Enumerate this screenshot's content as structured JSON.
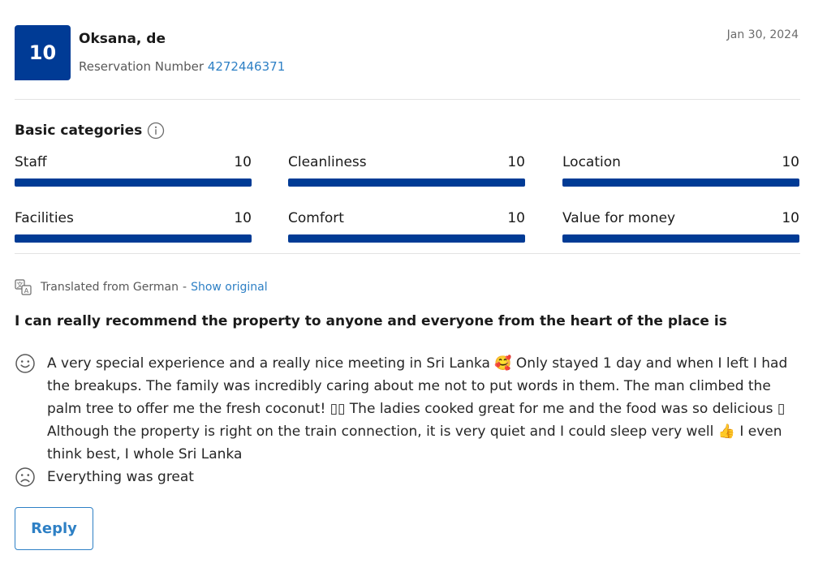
{
  "review": {
    "score": "10",
    "reviewer_name": "Oksana, de",
    "reservation_label": "Reservation Number",
    "reservation_number": "4272446371",
    "date": "Jan 30, 2024"
  },
  "categories": {
    "title": "Basic categories",
    "items": [
      {
        "label": "Staff",
        "score": "10"
      },
      {
        "label": "Cleanliness",
        "score": "10"
      },
      {
        "label": "Location",
        "score": "10"
      },
      {
        "label": "Facilities",
        "score": "10"
      },
      {
        "label": "Comfort",
        "score": "10"
      },
      {
        "label": "Value for money",
        "score": "10"
      }
    ]
  },
  "translation": {
    "label": "Translated from German",
    "separator": "-",
    "link": "Show original"
  },
  "review_title": "I can really recommend the property to anyone and everyone from the heart of the place is",
  "positive_text": "A very special experience and a really nice meeting in Sri Lanka 🥰 Only stayed 1 day and when I left I had the breakups. The family was incredibly caring about me not to put words in them. The man climbed the palm tree to offer me the fresh coconut! ▯▯ The ladies cooked great for me and the food was so delicious ▯ Although the property is right on the train connection, it is very quiet and I could sleep very well 👍 I even think best, I whole Sri Lanka",
  "negative_text": "Everything was great",
  "reply_button": "Reply",
  "colors": {
    "brand": "#003b95",
    "link": "#2e80c5"
  }
}
